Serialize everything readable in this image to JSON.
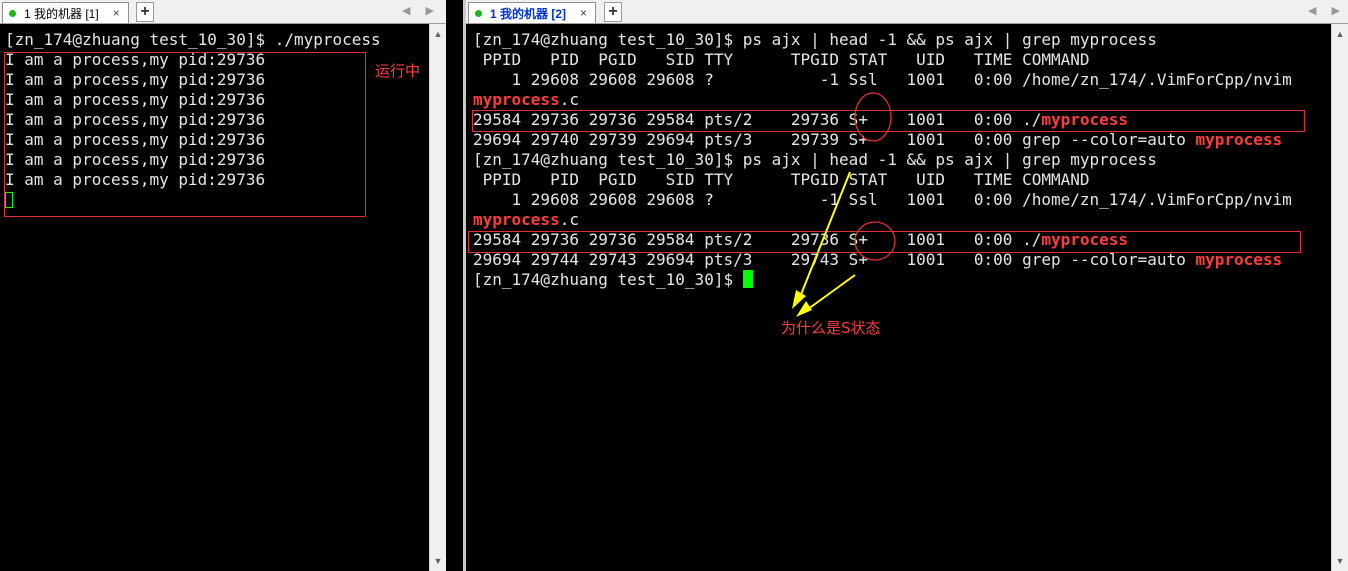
{
  "left_pane": {
    "tab": {
      "label": "1 我的机器 [1]"
    },
    "prompt_line": "[zn_174@zhuang test_10_30]$ ./myprocess",
    "output_lines": [
      "I am a process,my pid:29736",
      "I am a process,my pid:29736",
      "I am a process,my pid:29736",
      "I am a process,my pid:29736",
      "I am a process,my pid:29736",
      "I am a process,my pid:29736",
      "I am a process,my pid:29736"
    ],
    "annotation": "运行中"
  },
  "right_pane": {
    "tab": {
      "label": "1 我的机器 [2]"
    },
    "blocks": [
      {
        "command": "[zn_174@zhuang test_10_30]$ ps ajx | head -1 && ps ajx | grep myprocess",
        "header": " PPID   PID  PGID   SID TTY      TPGID STAT   UID   TIME COMMAND",
        "row1": "    1 29608 29608 29608 ?           -1 Ssl   1001   0:00 /home/zn_174/.VimForCpp/nvim",
        "row1_wrap_hl": "myprocess",
        "row1_wrap_rest": ".c",
        "row2_prefix": "29584 29736 29736 29584 pts/2    29736 S+    1001   0:00 ./",
        "row2_hl": "myprocess",
        "row3_prefix": "29694 29740 29739 29694 pts/3    29739 S+    1001   0:00 grep --color=auto ",
        "row3_hl": "myprocess"
      },
      {
        "command": "[zn_174@zhuang test_10_30]$ ps ajx | head -1 && ps ajx | grep myprocess",
        "header": " PPID   PID  PGID   SID TTY      TPGID STAT   UID   TIME COMMAND",
        "row1": "    1 29608 29608 29608 ?           -1 Ssl   1001   0:00 /home/zn_174/.VimForCpp/nvim",
        "row1_wrap_hl": "myprocess",
        "row1_wrap_rest": ".c",
        "row2_prefix": "29584 29736 29736 29584 pts/2    29736 S+    1001   0:00 ./",
        "row2_hl": "myprocess",
        "row3_prefix": "29694 29744 29743 29694 pts/3    29743 S+    1001   0:00 grep --color=auto ",
        "row3_hl": "myprocess"
      }
    ],
    "final_prompt": "[zn_174@zhuang test_10_30]$ ",
    "annotation": "为什么是S状态"
  },
  "colors": {
    "annotation_red": "#e0302f",
    "arrow_yellow": "#ffff00",
    "highlight_red": "#ff3b3b",
    "cursor_green": "#00ff00",
    "tab_active_blue": "#0033cc"
  },
  "icons": {
    "tab_status": "green-dot-icon",
    "tab_close": "close-icon",
    "new_tab": "plus-icon",
    "scroll_up": "triangle-up-icon",
    "scroll_down": "triangle-down-icon"
  }
}
